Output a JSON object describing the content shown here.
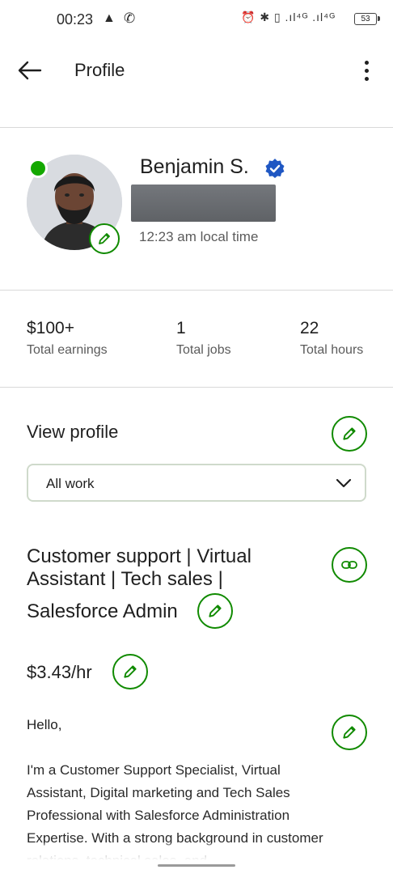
{
  "status_bar": {
    "time": "00:23",
    "right_icons": "⏰ ✱ ▯ .ıl⁴ᴳ .ıl⁴ᴳ",
    "battery": "53"
  },
  "header": {
    "title": "Profile"
  },
  "profile": {
    "name": "Benjamin S.",
    "local_time": "12:23 am local time"
  },
  "stats": [
    {
      "value": "$100+",
      "label": "Total earnings"
    },
    {
      "value": "1",
      "label": "Total jobs"
    },
    {
      "value": "22",
      "label": "Total hours"
    }
  ],
  "view_profile": {
    "title": "View profile",
    "filter_selected": "All work"
  },
  "job": {
    "title_line1": "Customer support | Virtual",
    "title_line2": "Assistant | Tech sales |",
    "title_line3": "Salesforce Admin",
    "rate": "$3.43/hr"
  },
  "bio": {
    "greeting": "Hello,",
    "text": "I'm a Customer Support Specialist, Virtual Assistant, Digital marketing and Tech Sales Professional with Salesforce Administration Expertise. With a strong background in customer relations, technical sales, and"
  },
  "colors": {
    "accent": "#108a00",
    "online": "#14a800",
    "verified": "#1f57c3"
  }
}
